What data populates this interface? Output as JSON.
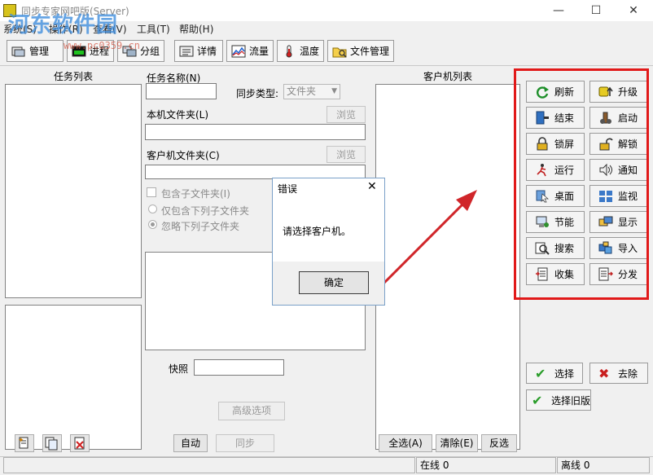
{
  "window": {
    "title": "同步专家网吧版(Server)",
    "minimize": "—",
    "maximize": "☐",
    "close": "✕"
  },
  "watermark": {
    "cn": "河东软件园",
    "url": "www.pc0359.cn"
  },
  "menu": [
    {
      "label": "系统(S)"
    },
    {
      "label": "操作(R)"
    },
    {
      "label": "查看(V)"
    },
    {
      "label": "工具(T)"
    },
    {
      "label": "帮助(H)"
    }
  ],
  "toolbar": [
    {
      "label": "管理",
      "icon": "manage-icon"
    },
    {
      "label": "进程",
      "icon": "process-icon"
    },
    {
      "label": "分组",
      "icon": "group-icon"
    },
    {
      "label": "详情",
      "icon": "details-icon"
    },
    {
      "label": "流量",
      "icon": "traffic-chart-icon"
    },
    {
      "label": "温度",
      "icon": "thermometer-icon"
    },
    {
      "label": "文件管理",
      "icon": "file-manager-icon"
    }
  ],
  "task_panel": {
    "header": "任务列表"
  },
  "task_form": {
    "name_label": "任务名称(N)",
    "name_value": "",
    "sync_type_label": "同步类型:",
    "sync_type_value": "文件夹",
    "local_folder_label": "本机文件夹(L)",
    "local_folder_value": "",
    "client_folder_label": "客户机文件夹(C)",
    "client_folder_value": "",
    "browse_label": "浏览",
    "include_subfolders_label": "包含子文件夹(I)",
    "radio_only_label": "仅包含下列子文件夹",
    "radio_ignore_label": "忽略下列子文件夹",
    "snapshot_label": "快照",
    "snapshot_value": "",
    "advanced_label": "高级选项",
    "auto_label": "自动",
    "sync_label": "同步"
  },
  "client_panel": {
    "header": "客户机列表",
    "select_all": "全选(A)",
    "clear": "清除(E)",
    "invert": "反选"
  },
  "actions": [
    {
      "label": "刷新",
      "icon": "refresh-icon"
    },
    {
      "label": "升级",
      "icon": "upgrade-icon"
    },
    {
      "label": "结束",
      "icon": "end-icon"
    },
    {
      "label": "启动",
      "icon": "start-icon"
    },
    {
      "label": "锁屏",
      "icon": "lock-icon"
    },
    {
      "label": "解锁",
      "icon": "unlock-icon"
    },
    {
      "label": "运行",
      "icon": "run-icon"
    },
    {
      "label": "通知",
      "icon": "speaker-icon"
    },
    {
      "label": "桌面",
      "icon": "desktop-icon"
    },
    {
      "label": "监视",
      "icon": "monitor-icon"
    },
    {
      "label": "节能",
      "icon": "power-save-icon"
    },
    {
      "label": "显示",
      "icon": "display-icon"
    },
    {
      "label": "搜索",
      "icon": "search-icon"
    },
    {
      "label": "导入",
      "icon": "import-icon"
    },
    {
      "label": "收集",
      "icon": "collect-icon"
    },
    {
      "label": "分发",
      "icon": "distribute-icon"
    }
  ],
  "select_buttons": {
    "select": "选择",
    "remove": "去除",
    "select_old": "选择旧版"
  },
  "dialog": {
    "title": "错误",
    "message": "请选择客户机。",
    "ok": "确定",
    "close": "✕"
  },
  "status": {
    "online": "在线 0",
    "offline": "离线 0"
  },
  "colors": {
    "highlight": "#e11919",
    "arrow": "#d0262a",
    "accent_green": "#2a9d2a",
    "accent_red": "#c81e1e"
  }
}
